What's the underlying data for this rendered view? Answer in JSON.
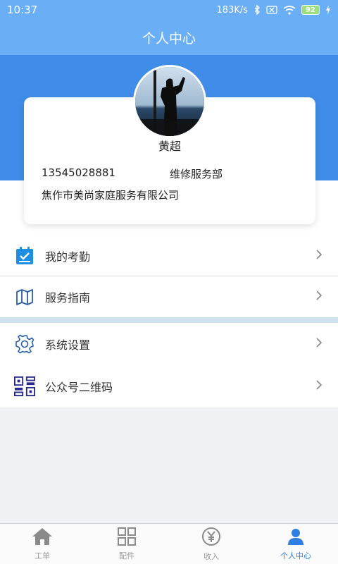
{
  "status_bar": {
    "time": "10:37",
    "network_speed": "183K/s",
    "battery_level": "92",
    "icons": [
      "bluetooth-icon",
      "sim-off-icon",
      "wifi-icon",
      "battery-icon",
      "charging-icon"
    ]
  },
  "header": {
    "title": "个人中心"
  },
  "profile": {
    "name": "黄超",
    "phone": "13545028881",
    "department": "维修服务部",
    "company": "焦作市美尚家庭服务有限公司"
  },
  "menu": {
    "attendance": "我的考勤",
    "service_guide": "服务指南",
    "settings": "系统设置",
    "qr_code": "公众号二维码"
  },
  "bottom_nav": {
    "items": [
      {
        "label": "工单",
        "icon": "home-icon"
      },
      {
        "label": "配件",
        "icon": "grid-icon"
      },
      {
        "label": "收入",
        "icon": "yuan-icon"
      },
      {
        "label": "个人中心",
        "icon": "person-icon"
      }
    ],
    "active_index": 3
  },
  "colors": {
    "primary": "#3f8de8",
    "header": "#6aaef6",
    "active_tab": "#2f7fe0",
    "attendance_icon": "#1e8ee0",
    "qr_icon": "#2a2a8c"
  }
}
